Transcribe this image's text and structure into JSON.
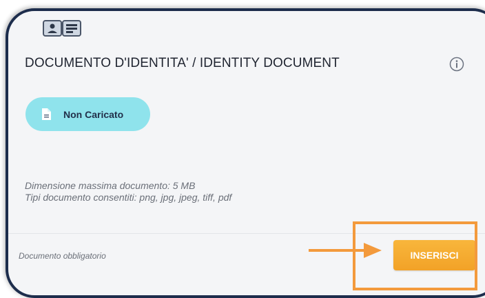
{
  "document_card": {
    "title": "DOCUMENTO D'IDENTITA' / IDENTITY DOCUMENT",
    "header_icon": "id-card-icon",
    "info_icon": "info-icon",
    "status": {
      "label": "Non Caricato",
      "icon": "file-icon",
      "color": "#8fe3ec"
    },
    "max_size_text": "Dimensione massima documento: 5 MB",
    "allowed_types_text": "Tipi documento consentiti: png, jpg, jpeg, tiff, pdf",
    "required_text": "Documento obbligatorio",
    "insert_button_label": "INSERISCI"
  },
  "annotation": {
    "arrow_icon": "arrow-right-icon",
    "highlight_color": "#f39a3c"
  },
  "colors": {
    "card_border": "#1d2d4c",
    "card_background": "#f4f5f7",
    "button": "#f5a830"
  }
}
